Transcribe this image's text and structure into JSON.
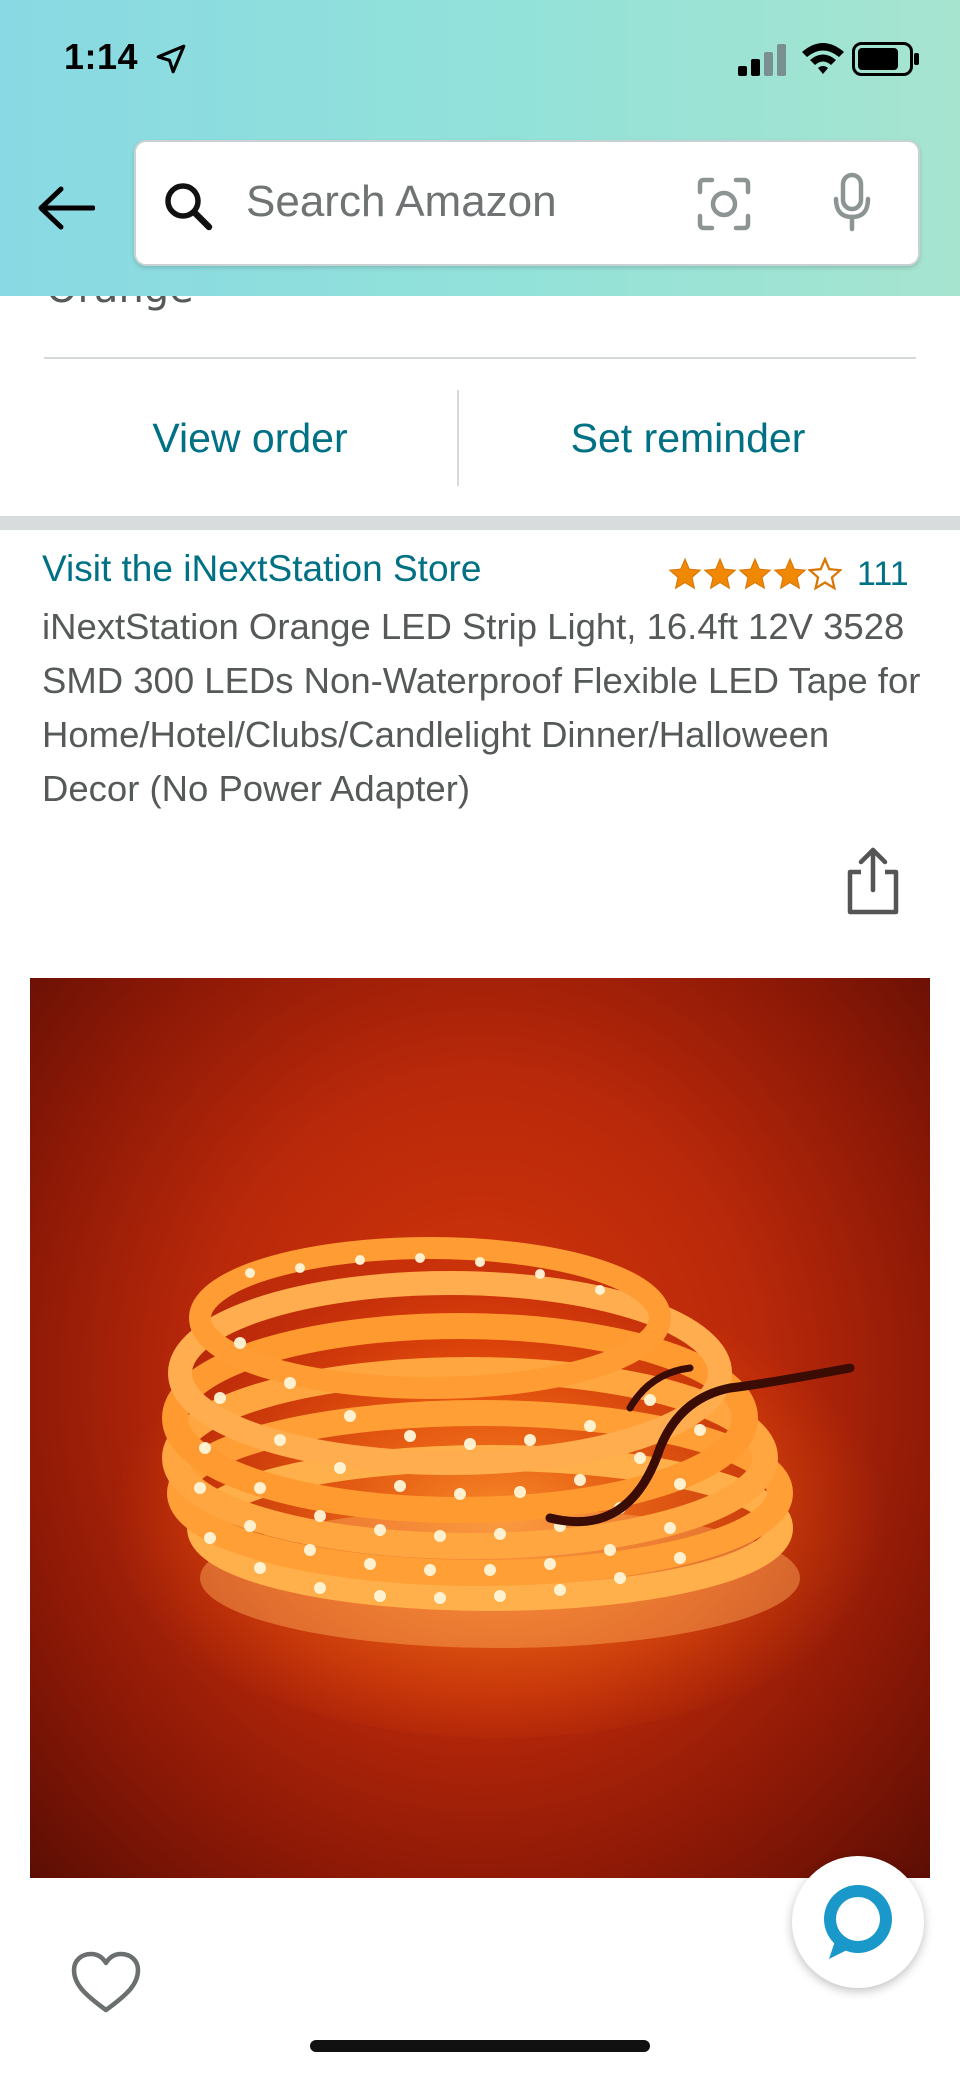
{
  "status_bar": {
    "time": "1:14",
    "location_icon": "location-arrow-icon",
    "signal_icon": "cellular-signal-icon",
    "wifi_icon": "wifi-icon",
    "battery_icon": "battery-icon"
  },
  "header": {
    "back_icon": "back-arrow-icon",
    "search": {
      "placeholder": "Search Amazon",
      "value": ""
    },
    "camera_icon": "camera-lens-icon",
    "mic_icon": "microphone-icon",
    "gradient_colors": [
      "#88d9e3",
      "#a6e4cf"
    ]
  },
  "order": {
    "color_value": "Orange",
    "actions": {
      "view_order": "View order",
      "set_reminder": "Set reminder"
    }
  },
  "product": {
    "store_link": "Visit the iNextStation Store",
    "rating": {
      "stars": 4.5,
      "count": "111"
    },
    "title": "iNextStation Orange LED Strip Light, 16.4ft 12V 3528 SMD 300 LEDs Non-Waterproof Flexible LED Tape for Home/Hotel/Clubs/Candlelight Dinner/Halloween Decor (No Power Adapter)",
    "share_icon": "share-icon",
    "image_subject": "orange-led-strip-coil",
    "wishlist_icon": "heart-icon"
  },
  "assistant": {
    "icon": "alexa-ring-icon"
  },
  "colors": {
    "link": "#007185",
    "star": "#f08804",
    "text_secondary": "#565959",
    "accent_ring": "#1a98c9"
  }
}
